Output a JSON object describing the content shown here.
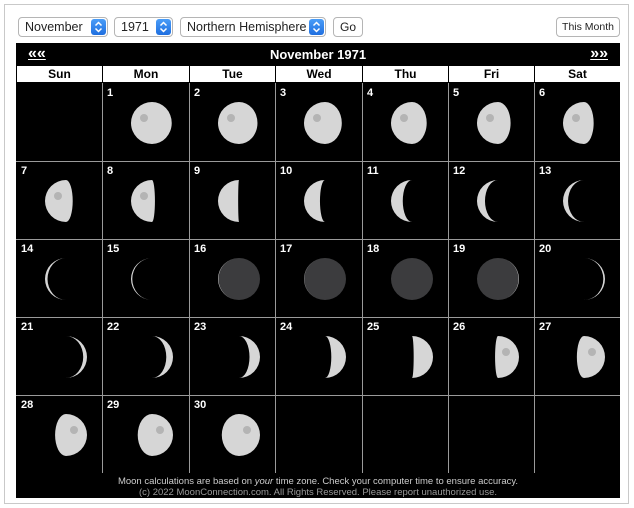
{
  "controls": {
    "month_value": "November",
    "year_value": "1971",
    "hemisphere_value": "Northern Hemisphere",
    "go_label": "Go",
    "this_month_label": "This Month"
  },
  "calendar": {
    "prev_label": "««",
    "next_label": "»»",
    "title": "November 1971",
    "weekdays": [
      "Sun",
      "Mon",
      "Tue",
      "Wed",
      "Thu",
      "Fri",
      "Sat"
    ],
    "first_weekday_index": 1,
    "days": [
      {
        "n": "1",
        "phase": "waning gibbous",
        "illum": 0.97
      },
      {
        "n": "2",
        "phase": "waning gibbous",
        "illum": 0.94
      },
      {
        "n": "3",
        "phase": "waning gibbous",
        "illum": 0.9
      },
      {
        "n": "4",
        "phase": "waning gibbous",
        "illum": 0.85
      },
      {
        "n": "5",
        "phase": "waning gibbous",
        "illum": 0.8
      },
      {
        "n": "6",
        "phase": "waning gibbous",
        "illum": 0.73
      },
      {
        "n": "7",
        "phase": "waning gibbous",
        "illum": 0.66
      },
      {
        "n": "8",
        "phase": "waning gibbous",
        "illum": 0.57
      },
      {
        "n": "9",
        "phase": "last quarter",
        "illum": 0.48
      },
      {
        "n": "10",
        "phase": "waning crescent",
        "illum": 0.38
      },
      {
        "n": "11",
        "phase": "waning crescent",
        "illum": 0.28
      },
      {
        "n": "12",
        "phase": "waning crescent",
        "illum": 0.19
      },
      {
        "n": "13",
        "phase": "waning crescent",
        "illum": 0.12
      },
      {
        "n": "14",
        "phase": "waning crescent",
        "illum": 0.06
      },
      {
        "n": "15",
        "phase": "waning crescent",
        "illum": 0.03
      },
      {
        "n": "16",
        "phase": "waning crescent",
        "illum": 0.01
      },
      {
        "n": "17",
        "phase": "waning crescent",
        "illum": 0.005
      },
      {
        "n": "18",
        "phase": "new moon",
        "illum": 0.0
      },
      {
        "n": "19",
        "phase": "waxing crescent",
        "illum": 0.01
      },
      {
        "n": "20",
        "phase": "waxing crescent",
        "illum": 0.04
      },
      {
        "n": "21",
        "phase": "waxing crescent",
        "illum": 0.09
      },
      {
        "n": "22",
        "phase": "waxing crescent",
        "illum": 0.16
      },
      {
        "n": "23",
        "phase": "waxing crescent",
        "illum": 0.25
      },
      {
        "n": "24",
        "phase": "waxing crescent",
        "illum": 0.35
      },
      {
        "n": "25",
        "phase": "first quarter",
        "illum": 0.46
      },
      {
        "n": "26",
        "phase": "waxing gibbous",
        "illum": 0.57
      },
      {
        "n": "27",
        "phase": "waxing gibbous",
        "illum": 0.67
      },
      {
        "n": "28",
        "phase": "waxing gibbous",
        "illum": 0.76
      },
      {
        "n": "29",
        "phase": "waxing gibbous",
        "illum": 0.84
      },
      {
        "n": "30",
        "phase": "waxing gibbous",
        "illum": 0.91
      }
    ]
  },
  "footer": {
    "line1": "Moon calculations are based on your time zone. Check your computer time to ensure accuracy.",
    "line2": "(c) 2022 MoonConnection.com. All Rights Reserved. Please report unauthorized use."
  },
  "colors": {
    "accent": "#1f6fe0",
    "calendar_bg": "#000000",
    "moon_light": "#d8d8d8",
    "moon_dark": "#3a3a3a"
  }
}
